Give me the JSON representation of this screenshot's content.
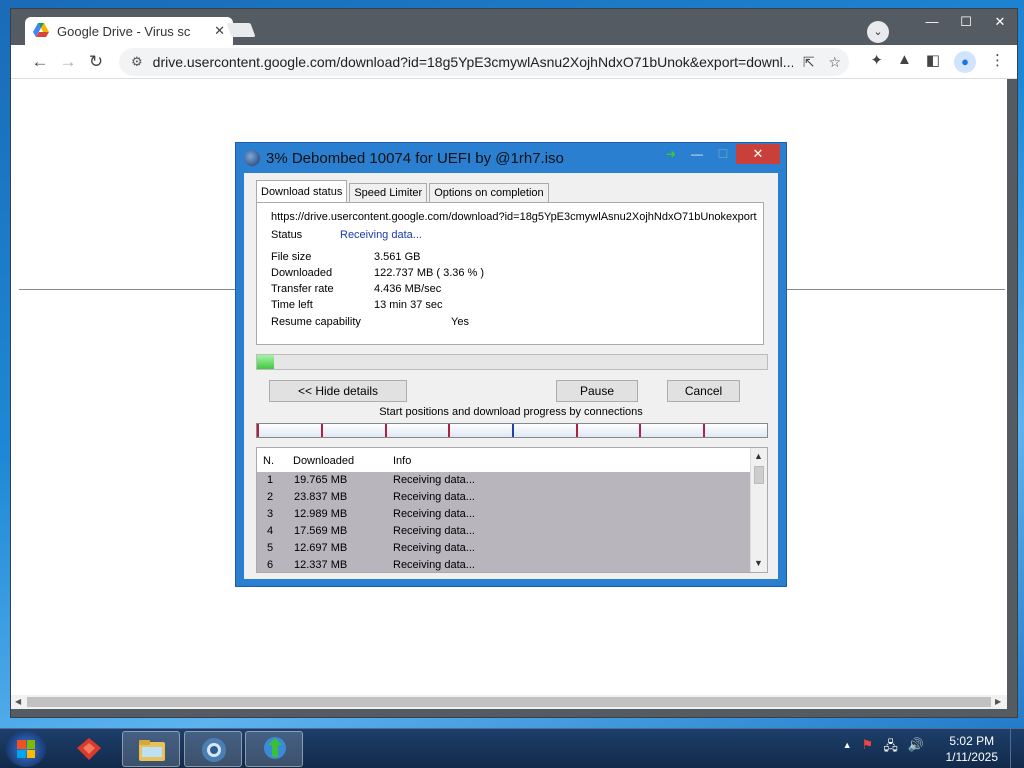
{
  "browser": {
    "tab_title": "Google Drive - Virus sc",
    "tab_close": "✕",
    "url": "drive.usercontent.google.com/download?id=18g5YpE3cmywlAsnu2XojhNdxO71bUnok&export=downl...",
    "window_buttons": [
      "—",
      "☐",
      "✕"
    ]
  },
  "idm": {
    "title": "3% Debombed 10074 for UEFI by @1rh7.iso",
    "tabs": [
      "Download status",
      "Speed Limiter",
      "Options on completion"
    ],
    "url": "https://drive.usercontent.google.com/download?id=18g5YpE3cmywlAsnu2XojhNdxO71bUnokexport",
    "status_label": "Status",
    "status_value": "Receiving data...",
    "file_size_label": "File size",
    "file_size_value": "3.561  GB",
    "downloaded_label": "Downloaded",
    "downloaded_value": "122.737  MB  ( 3.36 % )",
    "transfer_rate_label": "Transfer rate",
    "transfer_rate_value": "4.436  MB/sec",
    "time_left_label": "Time left",
    "time_left_value": "13 min 37 sec",
    "resume_label": "Resume capability",
    "resume_value": "Yes",
    "progress_fraction": 0.0336,
    "hide_details_button": "<< Hide details",
    "pause_button": "Pause",
    "cancel_button": "Cancel",
    "connections_label": "Start positions and download progress by connections",
    "list_headers": {
      "n": "N.",
      "downloaded": "Downloaded",
      "info": "Info"
    },
    "connections": [
      {
        "n": "1",
        "downloaded": "19.765  MB",
        "info": "Receiving data..."
      },
      {
        "n": "2",
        "downloaded": "23.837  MB",
        "info": "Receiving data..."
      },
      {
        "n": "3",
        "downloaded": "12.989  MB",
        "info": "Receiving data..."
      },
      {
        "n": "4",
        "downloaded": "17.569  MB",
        "info": "Receiving data..."
      },
      {
        "n": "5",
        "downloaded": "12.697  MB",
        "info": "Receiving data..."
      },
      {
        "n": "6",
        "downloaded": "12.337  MB",
        "info": "Receiving data..."
      }
    ]
  },
  "taskbar": {
    "time": "5:02 PM",
    "date": "1/11/2025"
  },
  "colors": {
    "idm_frame": "#2b7fd0",
    "progress_fill": "#41c741",
    "status_text": "#1a3aa8",
    "close_button": "#c9403a"
  }
}
